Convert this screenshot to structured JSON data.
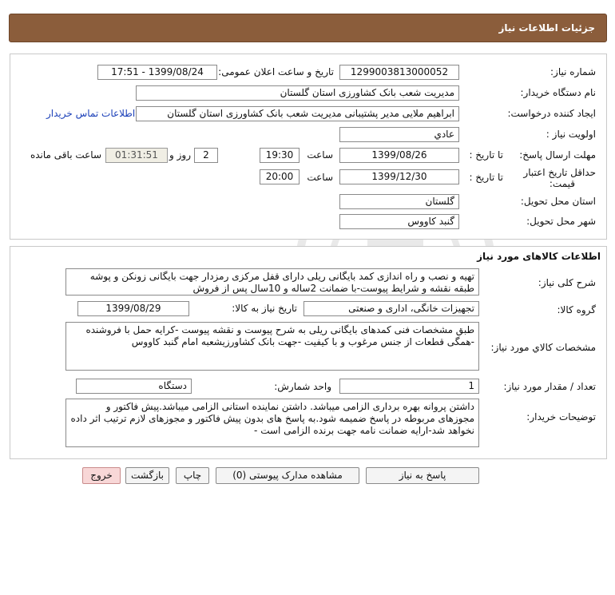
{
  "header": {
    "title": "جزئیات اطلاعات نیاز"
  },
  "details": {
    "need_number_label": "شماره نیاز:",
    "need_number": "1299003813000052",
    "announce_label": "تاریخ و ساعت اعلان عمومی:",
    "announce_value": "1399/08/24 - 17:51",
    "buyer_org_label": "نام دستگاه خریدار:",
    "buyer_org": "مدیریت شعب بانک کشاورزی استان گلستان",
    "requester_label": "ایجاد کننده درخواست:",
    "requester": "ابراهیم ملایی  مدیر پشتیبانی مدیریت شعب بانک کشاورزی استان گلستان",
    "contact_link": "اطلاعات تماس خریدار",
    "priority_label": "اولویت نیاز :",
    "priority": "عادي",
    "deadline_label": "مهلت ارسال پاسخ:",
    "to_date_label": "تا تاریخ :",
    "deadline_date": "1399/08/26",
    "time_label": "ساعت",
    "deadline_time": "19:30",
    "days_value": "2",
    "days_label": "روز و",
    "remaining_time": "01:31:51",
    "remaining_label": "ساعت باقی مانده",
    "validity_label_1": "حداقل تاریخ اعتبار",
    "validity_label_2": "قیمت:",
    "validity_date": "1399/12/30",
    "validity_time": "20:00",
    "province_label": "استان محل تحویل:",
    "province": "گلستان",
    "city_label": "شهر محل تحویل:",
    "city": "گنبد کاووس"
  },
  "goods": {
    "section_title": "اطلاعات کالاهای مورد نیاز",
    "summary_label": "شرح کلی نیاز:",
    "summary": "تهیه و نصب و راه اندازی کمد بایگانی ریلی دارای قفل مرکزی رمزدار جهت بایگانی زونکن و پوشه طبقه نقشه و شرایط پیوست-با ضمانت 2ساله و 10سال پس از فروش",
    "group_label": "گروه کالا:",
    "group": "تجهیزات خانگی، اداری و صنعتی",
    "need_date_label": "تاریخ نیاز به کالا:",
    "need_date": "1399/08/29",
    "spec_label": "مشخصات کالاي مورد نياز:",
    "spec": "طبق مشخصات فنی کمدهای بایگانی ریلی به شرح پیوست و نقشه پیوست -کرایه حمل با فروشنده -همگی قطعات از جنس مرغوب و با کیفیت -جهت بانک کشاورزیشعبه امام  گنبد کاووس",
    "qty_label": "تعداد / مقدار مورد نیاز:",
    "qty": "1",
    "unit_label": "واحد شمارش:",
    "unit": "دستگاه",
    "notes_label": "توضیحات خریدار:",
    "notes": "داشتن پروانه بهره برداری الزامی میباشد. داشتن نماینده استانی الزامی میباشد.پیش فاکتور و مجوزهای مربوطه در پاسخ ضمیمه شود.به پاسخ های بدون پیش فاکتور و مجوزهای لازم ترتیب اثر داده نخواهد شد-ارایه ضمانت نامه جهت برنده الزامی است -"
  },
  "actions": {
    "reply": "پاسخ به نیاز",
    "attachments": "مشاهده مدارک پیوستی (0)",
    "print": "چاپ",
    "back": "بازگشت",
    "exit": "خروج"
  },
  "colors": {
    "header_bg": "#8b5d3b",
    "link": "#1a3fb8",
    "exit_bg": "#f8d7d7"
  }
}
